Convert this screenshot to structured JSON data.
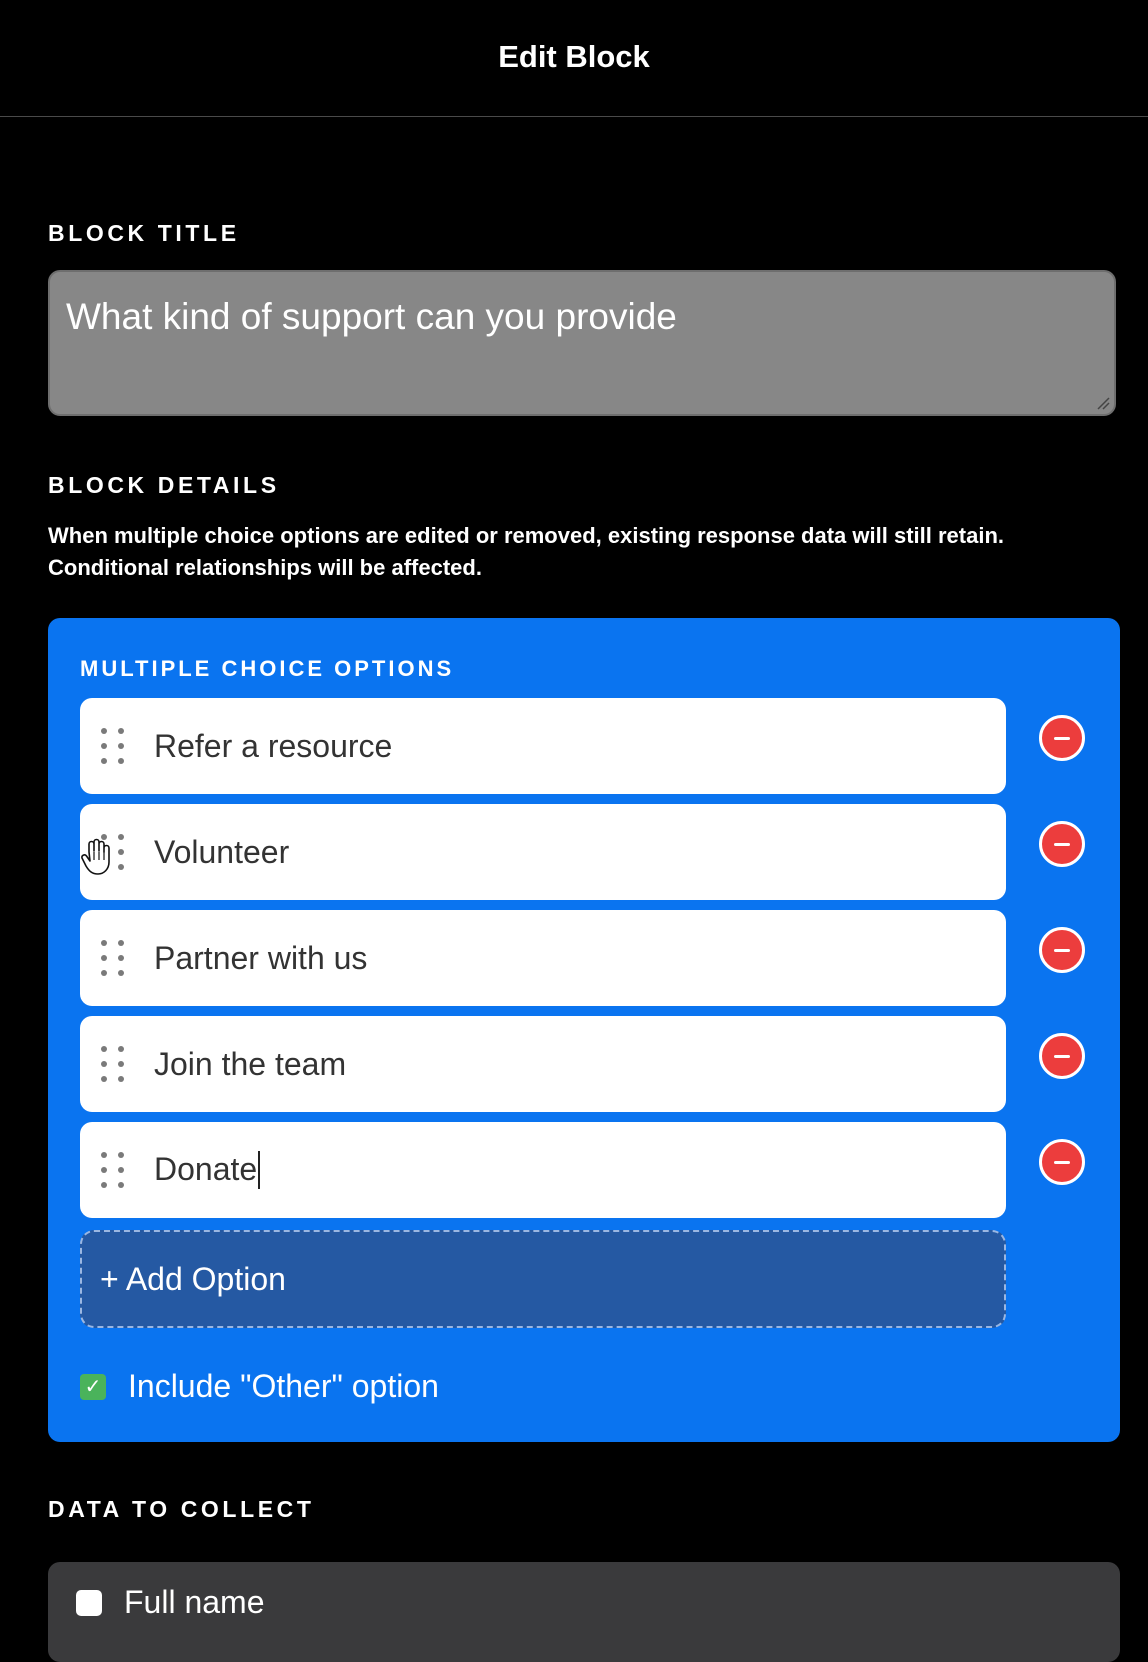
{
  "header": {
    "title": "Edit Block"
  },
  "block_title": {
    "label": "BLOCK TITLE",
    "value": "What kind of support can you provide"
  },
  "block_details": {
    "label": "BLOCK DETAILS",
    "description_line1": "When multiple choice options are edited or removed, existing response data will still retain.",
    "description_line2": "Conditional relationships will be affected."
  },
  "choices": {
    "label": "MULTIPLE CHOICE OPTIONS",
    "options": [
      {
        "text": "Refer a resource"
      },
      {
        "text": "Volunteer"
      },
      {
        "text": "Partner with us"
      },
      {
        "text": "Join the team"
      },
      {
        "text": "Donate"
      }
    ],
    "add_option_label": "+ Add Option",
    "include_other_label": "Include \"Other\" option",
    "include_other_checked": true
  },
  "data_to_collect": {
    "label": "DATA TO COLLECT",
    "items": [
      {
        "label": "Full name",
        "checked": false
      }
    ]
  },
  "colors": {
    "panel_blue": "#0a74f0",
    "add_option_bg": "#2559a3",
    "remove_red": "#ec3d3d",
    "check_green": "#4ab35b"
  },
  "icons": {
    "drag": "drag-handle-icon",
    "remove": "minus-circle-icon",
    "cursor": "hand-cursor-icon"
  }
}
